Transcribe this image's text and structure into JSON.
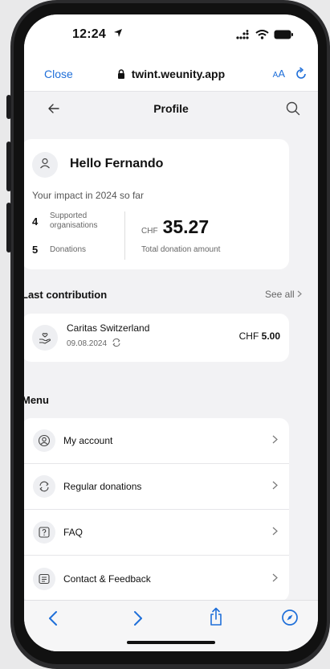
{
  "status_bar": {
    "time": "12:24"
  },
  "browser": {
    "close_label": "Close",
    "url": "twint.weunity.app",
    "aa_label_small": "A",
    "aa_label_big": "A"
  },
  "header": {
    "title": "Profile"
  },
  "hello_card": {
    "greeting": "Hello Fernando",
    "impact_text": "Your impact in 2024 so far",
    "supported_count": "4",
    "supported_label_1": "Supported",
    "supported_label_2": "organisations",
    "donations_count": "5",
    "donations_label": "Donations",
    "currency": "CHF",
    "total_amount": "35.27",
    "total_label": "Total donation amount"
  },
  "last_contribution": {
    "section_title": "Last contribution",
    "see_all_label": "See all",
    "name": "Caritas Switzerland",
    "date": "09.08.2024",
    "currency": "CHF",
    "amount": "5.00"
  },
  "menu": {
    "section_title": "Menu",
    "items": [
      {
        "label": "My account",
        "icon": "user-circle-icon"
      },
      {
        "label": "Regular donations",
        "icon": "recurring-icon"
      },
      {
        "label": "FAQ",
        "icon": "question-icon"
      },
      {
        "label": "Contact & Feedback",
        "icon": "chat-icon"
      }
    ]
  },
  "colors": {
    "accent": "#1f6fd9",
    "background": "#f2f2f4",
    "card": "#ffffff"
  }
}
